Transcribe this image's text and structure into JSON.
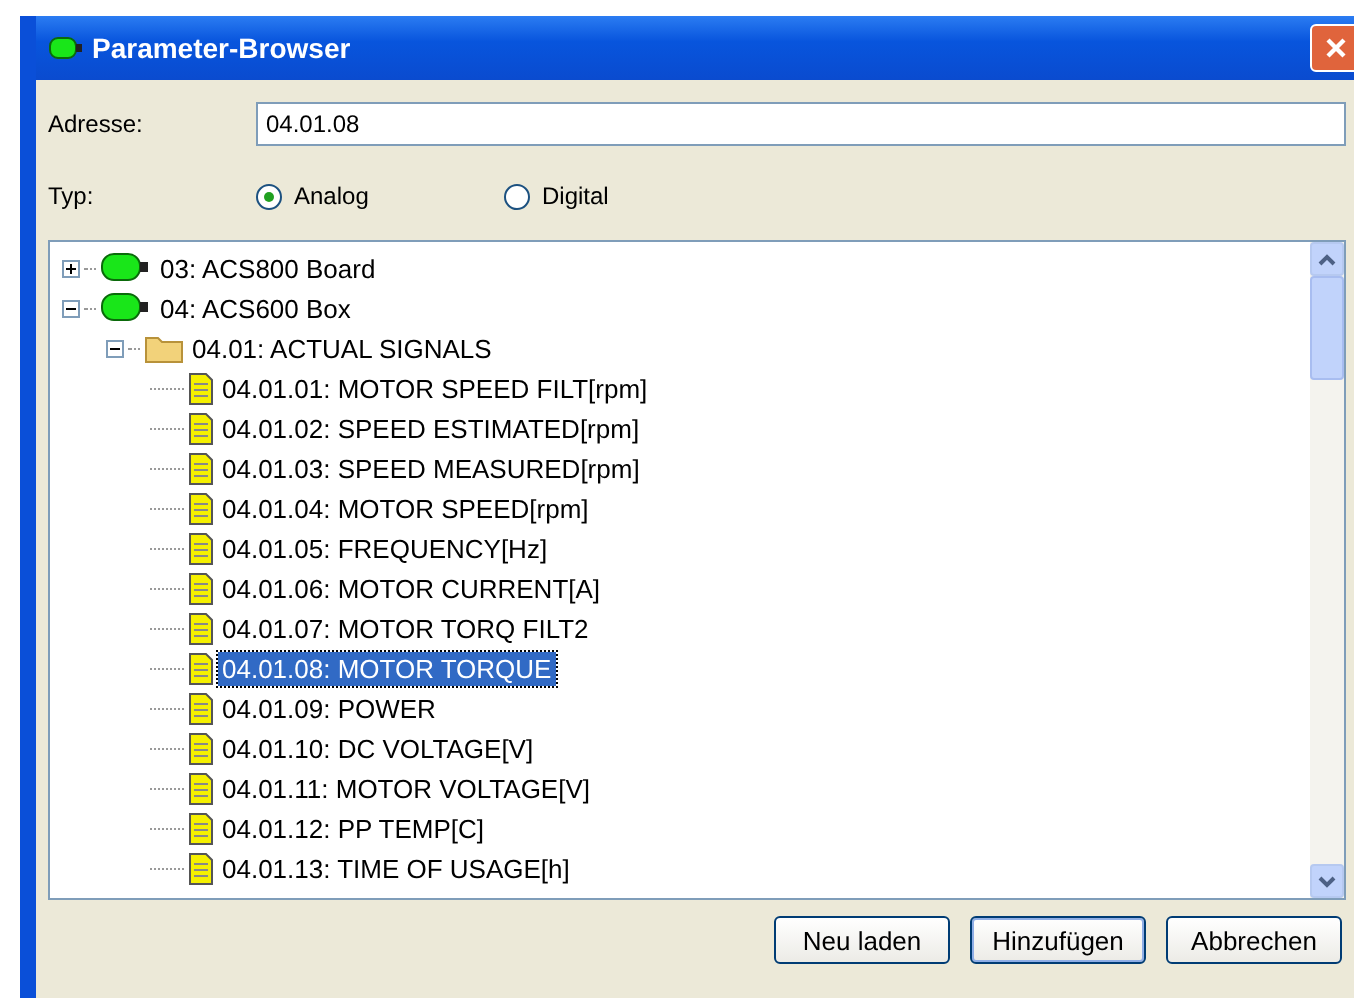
{
  "window": {
    "title": "Parameter-Browser"
  },
  "address": {
    "label": "Adresse:",
    "value": "04.01.08"
  },
  "type": {
    "label": "Typ:",
    "options": [
      {
        "label": "Analog",
        "selected": true
      },
      {
        "label": "Digital",
        "selected": false
      }
    ]
  },
  "tree": [
    {
      "kind": "device",
      "label": "03: ACS800 Board",
      "expanded": false
    },
    {
      "kind": "device",
      "label": "04: ACS600 Box",
      "expanded": true,
      "children": [
        {
          "kind": "folder",
          "label": "04.01: ACTUAL SIGNALS",
          "expanded": true,
          "children": [
            {
              "kind": "param",
              "label": "04.01.01: MOTOR SPEED FILT[rpm]",
              "selected": false
            },
            {
              "kind": "param",
              "label": "04.01.02: SPEED ESTIMATED[rpm]",
              "selected": false
            },
            {
              "kind": "param",
              "label": "04.01.03: SPEED MEASURED[rpm]",
              "selected": false
            },
            {
              "kind": "param",
              "label": "04.01.04: MOTOR SPEED[rpm]",
              "selected": false
            },
            {
              "kind": "param",
              "label": "04.01.05: FREQUENCY[Hz]",
              "selected": false
            },
            {
              "kind": "param",
              "label": "04.01.06: MOTOR CURRENT[A]",
              "selected": false
            },
            {
              "kind": "param",
              "label": "04.01.07: MOTOR TORQ FILT2",
              "selected": false
            },
            {
              "kind": "param",
              "label": "04.01.08: MOTOR TORQUE",
              "selected": true
            },
            {
              "kind": "param",
              "label": "04.01.09: POWER",
              "selected": false
            },
            {
              "kind": "param",
              "label": "04.01.10: DC VOLTAGE[V]",
              "selected": false
            },
            {
              "kind": "param",
              "label": "04.01.11: MOTOR VOLTAGE[V]",
              "selected": false
            },
            {
              "kind": "param",
              "label": "04.01.12: PP TEMP[C]",
              "selected": false
            },
            {
              "kind": "param",
              "label": "04.01.13: TIME OF USAGE[h]",
              "selected": false
            }
          ]
        }
      ]
    }
  ],
  "buttons": [
    "Neu laden",
    "Hinzufügen",
    "Abbrechen"
  ]
}
